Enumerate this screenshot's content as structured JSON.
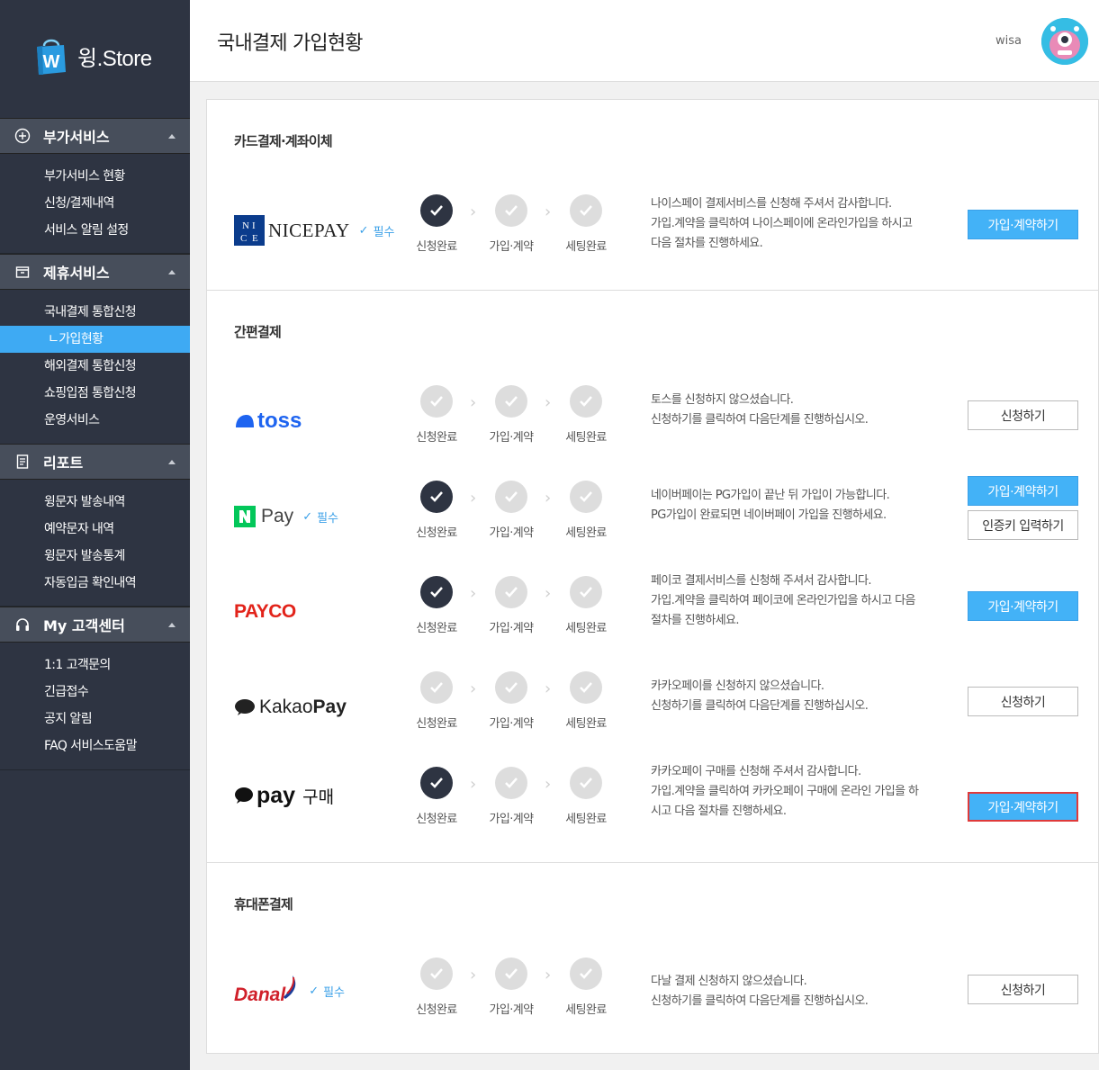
{
  "brand": {
    "name": "윙.Store",
    "bag_letter": "W"
  },
  "sidebar": {
    "sections": [
      {
        "title": "부가서비스",
        "icon": "plus-circle-icon",
        "items": [
          "부가서비스 현황",
          "신청/결제내역",
          "서비스 알림 설정"
        ]
      },
      {
        "title": "제휴서비스",
        "icon": "box-icon",
        "items": [
          "국내결제 통합신청",
          "ㄴ가입현황",
          "해외결제 통합신청",
          "쇼핑입점 통합신청",
          "운영서비스"
        ]
      },
      {
        "title": "리포트",
        "icon": "report-icon",
        "items": [
          "윙문자 발송내역",
          "예약문자 내역",
          "윙문자 발송통계",
          "자동입금 확인내역"
        ]
      },
      {
        "title": "My 고객센터",
        "icon": "headset-icon",
        "items": [
          "1:1 고객문의",
          "긴급접수",
          "공지 알림",
          "FAQ 서비스도움말"
        ]
      }
    ],
    "active_item": "ㄴ가입현황"
  },
  "header": {
    "title": "국내결제 가입현황",
    "user": "wisa"
  },
  "step_labels": [
    "신청완료",
    "가입·계약",
    "세팅완료"
  ],
  "required_label": "필수",
  "sections": [
    {
      "title": "카드결제·계좌이체",
      "rows": [
        {
          "provider": "NICEPAY",
          "logo_text": "NICEPAY",
          "required": true,
          "steps_done": 1,
          "desc": [
            "나이스페이 결제서비스를 신청해 주셔서 감사합니다.",
            "가입.계약을 클릭하여 나이스페이에 온라인가입을 하시고",
            "다음 절차를 진행하세요."
          ],
          "buttons": [
            {
              "label": "가입·계약하기",
              "style": "primary"
            }
          ]
        }
      ]
    },
    {
      "title": "간편결제",
      "rows": [
        {
          "provider": "toss",
          "logo_text": "toss",
          "required": false,
          "steps_done": 0,
          "desc": [
            "토스를 신청하지 않으셨습니다.",
            "신청하기를 클릭하여 다음단계를 진행하십시오."
          ],
          "buttons": [
            {
              "label": "신청하기",
              "style": "outline"
            }
          ]
        },
        {
          "provider": "N Pay",
          "logo_text": "Pay",
          "required": true,
          "steps_done": 1,
          "desc": [
            "네이버페이는 PG가입이 끝난 뒤 가입이 가능합니다.",
            "PG가입이 완료되면 네이버페이 가입을 진행하세요."
          ],
          "buttons": [
            {
              "label": "가입·계약하기",
              "style": "primary"
            },
            {
              "label": "인증키 입력하기",
              "style": "outline"
            }
          ]
        },
        {
          "provider": "PAYCO",
          "logo_text": "PAYCO",
          "required": false,
          "steps_done": 1,
          "desc": [
            "페이코 결제서비스를 신청해 주셔서 감사합니다.",
            "가입.계약을 클릭하여 페이코에 온라인가입을 하시고 다음",
            "절차를 진행하세요."
          ],
          "buttons": [
            {
              "label": "가입·계약하기",
              "style": "primary"
            }
          ]
        },
        {
          "provider": "KakaoPay",
          "logo_text": [
            "Kakao",
            "Pay"
          ],
          "required": false,
          "steps_done": 0,
          "desc": [
            "카카오페이를 신청하지 않으셨습니다.",
            "신청하기를 클릭하여 다음단계를 진행하십시오."
          ],
          "buttons": [
            {
              "label": "신청하기",
              "style": "outline"
            }
          ]
        },
        {
          "provider": "pay 구매",
          "logo_text": [
            "pay",
            "구매"
          ],
          "required": false,
          "steps_done": 1,
          "desc": [
            "카카오페이 구매를 신청해 주셔서 감사합니다.",
            "가입.계약을 클릭하여 카카오페이 구매에 온라인 가입을 하",
            "시고 다음 절차를 진행하세요."
          ],
          "buttons": [
            {
              "label": "가입·계약하기",
              "style": "primary-focus"
            }
          ]
        }
      ]
    },
    {
      "title": "휴대폰결제",
      "rows": [
        {
          "provider": "Danal",
          "logo_text": "Danal",
          "required": true,
          "steps_done": 0,
          "desc": [
            "다날 결제 신청하지 않으셨습니다.",
            "신청하기를 클릭하여 다음단계를 진행하십시오."
          ],
          "buttons": [
            {
              "label": "신청하기",
              "style": "outline"
            }
          ]
        }
      ]
    }
  ],
  "colors": {
    "sidebar_bg": "#2e3442",
    "accent": "#43b2f7",
    "step_done": "#2e3442",
    "step_pending": "#dddddd"
  }
}
